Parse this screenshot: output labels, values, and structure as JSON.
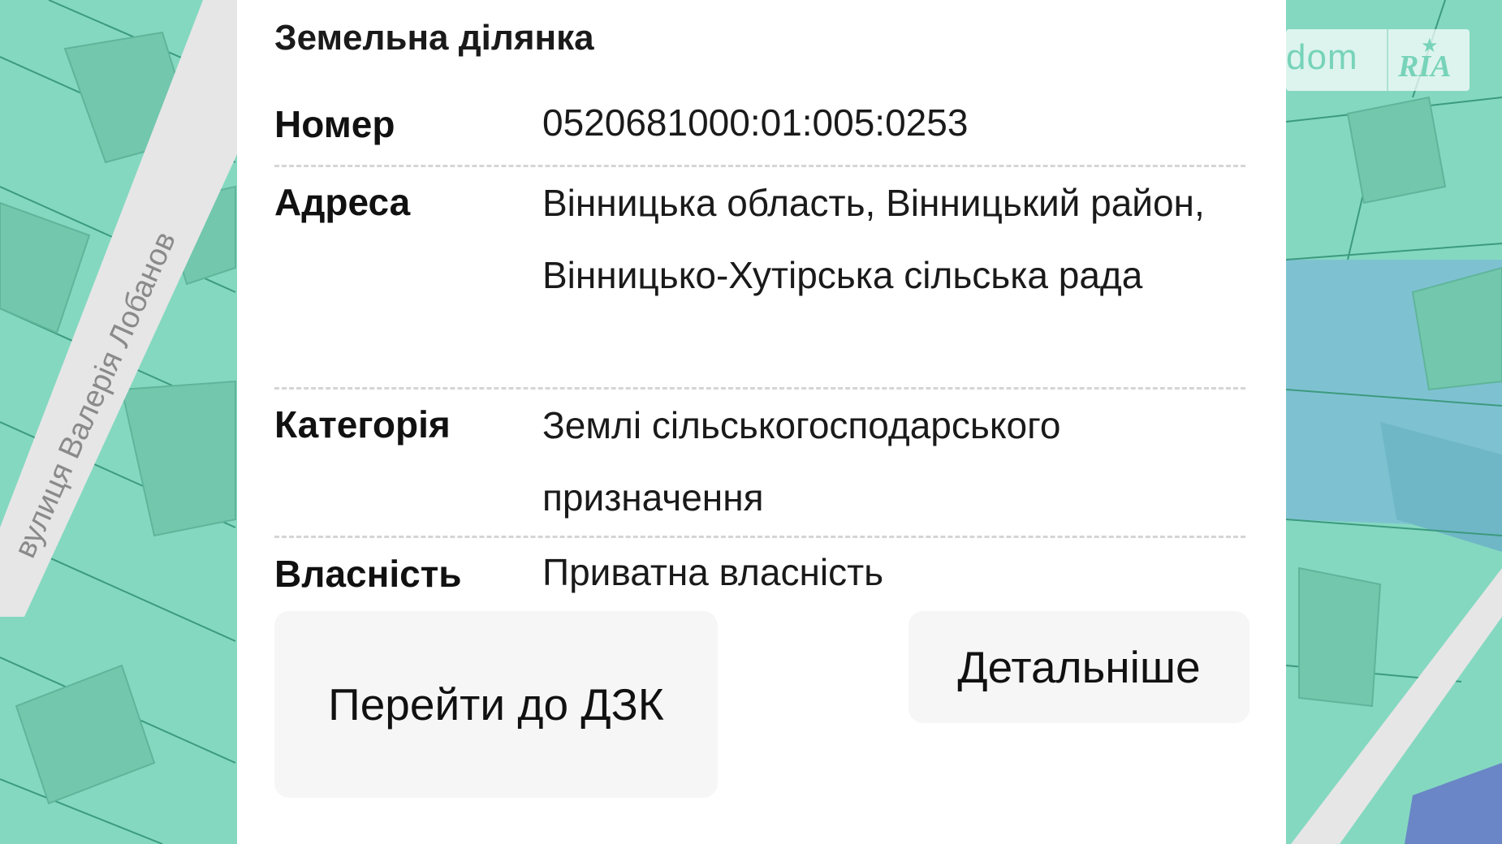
{
  "map": {
    "street_label": "вулиця Валерія Лобанов",
    "colors": {
      "parcel_green": "#84d8c0",
      "parcel_blue": "#7ec2d2",
      "road": "#e4e4e4",
      "line": "#2f8f74"
    }
  },
  "logo": {
    "dom": "dom",
    "ria": "RIA"
  },
  "panel": {
    "title": "Земельна ділянка",
    "rows": [
      {
        "label": "Номер",
        "value": "0520681000:01:005:0253"
      },
      {
        "label": "Адреса",
        "value": "Вінницька область, Вінницький район, Вінницько-Хутірська сільська рада"
      },
      {
        "label": "Категорія",
        "value": "Землі сільськогосподарського призначення"
      },
      {
        "label": "Власність",
        "value": "Приватна власність"
      }
    ],
    "buttons": {
      "dzk": "Перейти до ДЗК",
      "details": "Детальніше"
    }
  }
}
